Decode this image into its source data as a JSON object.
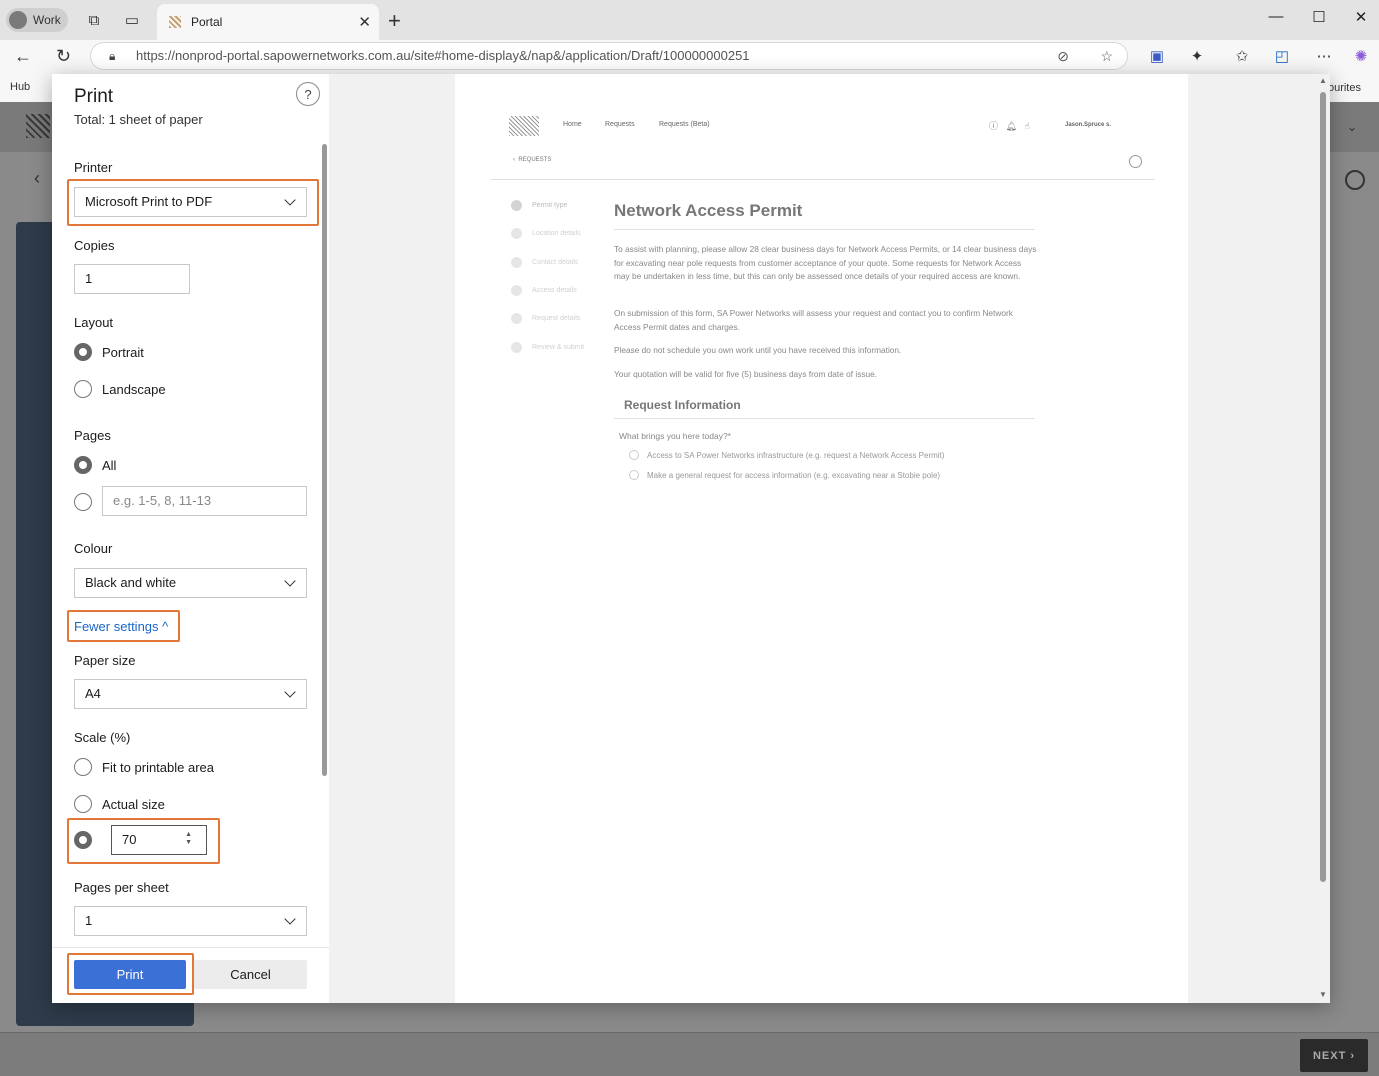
{
  "browser": {
    "profile_label": "Work",
    "tab_title": "Portal",
    "url": "https://nonprod-portal.sapowernetworks.com.au/site#home-display&/nap&/application/Draft/100000000251",
    "favourites_left": "Hub",
    "favourites_right": "vourites"
  },
  "print_dialog": {
    "title": "Print",
    "subtitle": "Total: 1 sheet of paper",
    "help_label": "?",
    "printer": {
      "label": "Printer",
      "value": "Microsoft Print to PDF"
    },
    "copies": {
      "label": "Copies",
      "value": "1"
    },
    "layout": {
      "label": "Layout",
      "options": [
        "Portrait",
        "Landscape"
      ],
      "selected": "Portrait"
    },
    "pages": {
      "label": "Pages",
      "all_label": "All",
      "custom_placeholder": "e.g. 1-5, 8, 11-13"
    },
    "colour": {
      "label": "Colour",
      "value": "Black and white"
    },
    "fewer_settings": "Fewer settings ^",
    "paper_size": {
      "label": "Paper size",
      "value": "A4"
    },
    "scale": {
      "label": "Scale (%)",
      "fit_label": "Fit to printable area",
      "actual_label": "Actual size",
      "custom_value": "70"
    },
    "pages_per_sheet": {
      "label": "Pages per sheet",
      "value": "1"
    },
    "print_button": "Print",
    "cancel_button": "Cancel"
  },
  "preview": {
    "nav": [
      "Home",
      "Requests",
      "Requests (Beta)"
    ],
    "user": "Jason.Spruce s.",
    "back_label": "REQUESTS",
    "steps": [
      "Permit type",
      "Location details",
      "Contact details",
      "Access details",
      "Request details",
      "Review & submit"
    ],
    "title": "Network Access Permit",
    "paragraphs": [
      "To assist with planning, please allow 28 clear business days for Network Access Permits, or 14 clear business days for excavating near pole requests from customer acceptance of your quote. Some requests for Network Access may be undertaken in less time, but this can only be assessed once details of your required access are known.",
      "On submission of this form, SA Power Networks will assess your request and contact you to confirm Network Access Permit dates and charges.",
      "Please do not schedule you own work until you have received this information.",
      "Your quotation will be valid for five (5) business days from date of issue."
    ],
    "section_title": "Request Information",
    "question": "What brings you here today?*",
    "options": [
      "Access to SA Power Networks infrastructure (e.g. request a Network Access Permit)",
      "Make a general request for access information (e.g. excavating near a Stobie pole)"
    ]
  },
  "background_page": {
    "next_button": "NEXT"
  },
  "colors": {
    "accent": "#3b70d6",
    "highlight": "#e2773a",
    "link": "#1a66c9"
  }
}
